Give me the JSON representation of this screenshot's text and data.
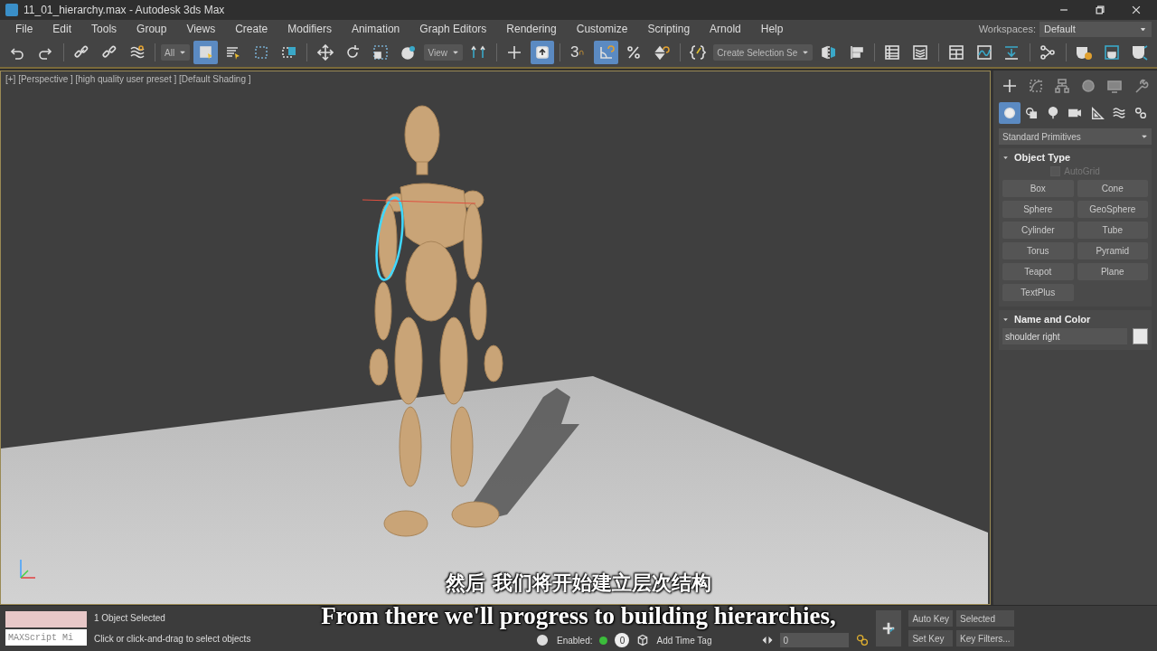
{
  "window": {
    "title": "11_01_hierarchy.max - Autodesk 3ds Max"
  },
  "menu": [
    "File",
    "Edit",
    "Tools",
    "Group",
    "Views",
    "Create",
    "Modifiers",
    "Animation",
    "Graph Editors",
    "Rendering",
    "Customize",
    "Scripting",
    "Arnold",
    "Help"
  ],
  "workspaces": {
    "label": "Workspaces:",
    "value": "Default"
  },
  "toolbar": [
    {
      "kind": "tool",
      "selected": false
    },
    {
      "kind": "tool",
      "selected": false
    },
    {
      "kind": "sep"
    },
    {
      "kind": "tool",
      "selected": false
    },
    {
      "kind": "tool",
      "selected": false
    },
    {
      "kind": "tool",
      "selected": false
    },
    {
      "kind": "sep"
    },
    {
      "kind": "dropdown",
      "value": "All"
    },
    {
      "kind": "tool",
      "selected": true
    },
    {
      "kind": "tool",
      "selected": false
    },
    {
      "kind": "tool",
      "selected": false
    },
    {
      "kind": "tool",
      "selected": false
    },
    {
      "kind": "sep"
    },
    {
      "kind": "tool",
      "selected": false
    },
    {
      "kind": "tool",
      "selected": false
    },
    {
      "kind": "tool",
      "selected": false
    },
    {
      "kind": "tool",
      "selected": false
    },
    {
      "kind": "dropdown",
      "value": "View"
    },
    {
      "kind": "tool",
      "selected": false
    },
    {
      "kind": "sep"
    },
    {
      "kind": "tool",
      "selected": false
    },
    {
      "kind": "tool",
      "selected": true
    },
    {
      "kind": "sep"
    },
    {
      "kind": "tool",
      "selected": false,
      "label": "3"
    },
    {
      "kind": "tool",
      "selected": true
    },
    {
      "kind": "tool",
      "selected": false
    },
    {
      "kind": "tool",
      "selected": false
    },
    {
      "kind": "sep"
    },
    {
      "kind": "tool",
      "selected": false
    },
    {
      "kind": "dropdown",
      "value": "Create Selection Se"
    },
    {
      "kind": "tool",
      "selected": false
    },
    {
      "kind": "tool",
      "selected": false
    },
    {
      "kind": "sep"
    },
    {
      "kind": "tool",
      "selected": false
    },
    {
      "kind": "tool",
      "selected": false
    },
    {
      "kind": "sep"
    },
    {
      "kind": "tool",
      "selected": false
    },
    {
      "kind": "tool",
      "selected": false
    },
    {
      "kind": "tool",
      "selected": false
    },
    {
      "kind": "sep"
    },
    {
      "kind": "tool",
      "selected": false
    },
    {
      "kind": "sep"
    },
    {
      "kind": "tool",
      "selected": false
    },
    {
      "kind": "tool",
      "selected": false
    },
    {
      "kind": "tool",
      "selected": false
    }
  ],
  "viewport": {
    "label": "[+] [Perspective ] [high quality user preset ] [Default Shading ]"
  },
  "command_panel": {
    "tabs": [
      {
        "selected": true
      },
      {
        "selected": false
      },
      {
        "selected": false
      },
      {
        "selected": false
      },
      {
        "selected": false
      },
      {
        "selected": false
      }
    ],
    "categories": [
      {
        "selected": true
      },
      {
        "selected": false
      },
      {
        "selected": false
      },
      {
        "selected": false
      },
      {
        "selected": false
      },
      {
        "selected": false
      },
      {
        "selected": false
      }
    ],
    "dropdown": "Standard Primitives",
    "object_type": {
      "title": "Object Type",
      "expanded": true,
      "autogrid": {
        "label": "AutoGrid",
        "checked": false,
        "disabled": true
      },
      "buttons": [
        "Box",
        "Cone",
        "Sphere",
        "GeoSphere",
        "Cylinder",
        "Tube",
        "Torus",
        "Pyramid",
        "Teapot",
        "Plane",
        "TextPlus"
      ]
    },
    "name_and_color": {
      "title": "Name and Color",
      "expanded": true,
      "name": "shoulder right",
      "color": "#e8e8e8"
    }
  },
  "status_bar": {
    "listener": "MAXScript Mi",
    "selection": "1 Object Selected",
    "prompt": "Click or click-and-drag to select objects",
    "enabled_label": "Enabled:",
    "enabled": true,
    "tag_count": "0",
    "add_time_tag": "Add Time Tag",
    "frame": "0",
    "auto_key": "Auto Key",
    "selected_dropdown": "Selected",
    "set_key": "Set Key",
    "key_filters": "Key Filters..."
  },
  "subtitles": [
    "然后 我们将开始建立层次结构",
    "From there we'll progress to building hierarchies,"
  ]
}
